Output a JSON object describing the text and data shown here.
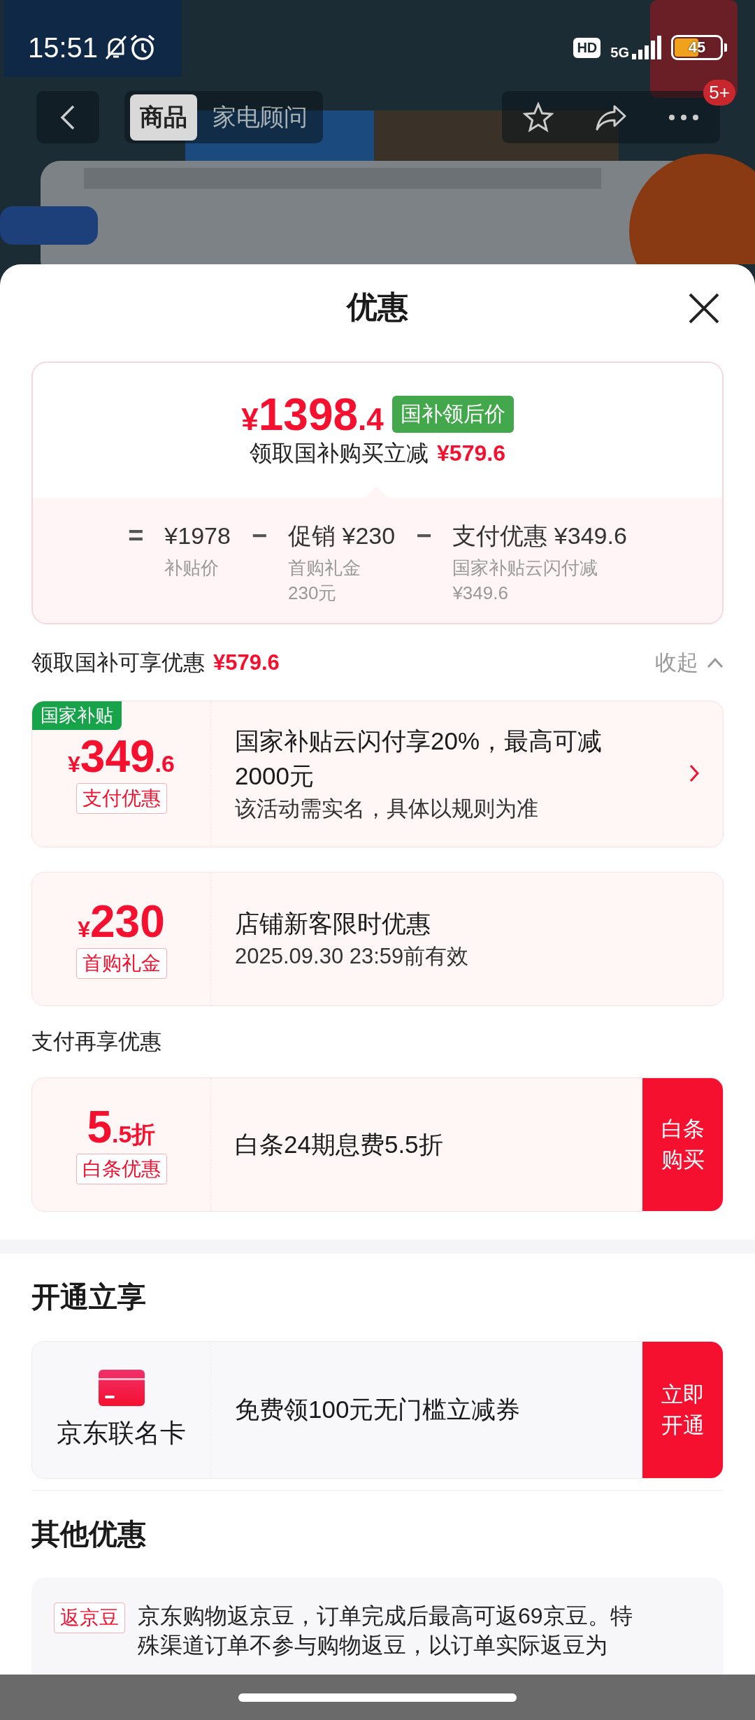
{
  "status_bar": {
    "time": "15:51",
    "hd": "HD",
    "network": "5G",
    "battery": "45"
  },
  "nav": {
    "tabs": [
      {
        "label": "商品",
        "selected": true
      },
      {
        "label": "家电顾问",
        "selected": false
      }
    ],
    "badge": "5+"
  },
  "sheet": {
    "title": "优惠"
  },
  "price_card": {
    "price": {
      "symbol": "¥",
      "integer": "1398",
      "decimal": ".4"
    },
    "tag": "国补领后价",
    "subtitle": "领取国补购买立减",
    "subtitle_amount": "¥579.6",
    "breakdown": [
      {
        "op": "=",
        "value": "¥1978",
        "label": "补贴价"
      },
      {
        "op": "−",
        "value": "促销 ¥230",
        "label": "首购礼金",
        "note": "230元"
      },
      {
        "op": "−",
        "value": "支付优惠 ¥349.6",
        "label": "国家补贴云闪付减",
        "note": "¥349.6"
      }
    ]
  },
  "summary": {
    "label": "领取国补可享优惠",
    "amount": "¥579.6",
    "toggle": "收起",
    "expanded": true
  },
  "coupons": [
    {
      "ribbon": "国家补贴",
      "symbol": "¥",
      "main": "349",
      "decimal": ".6",
      "tag": "支付优惠",
      "title": "国家补贴云闪付享20%，最高可减2000元",
      "desc": "该活动需实名，具体以规则为准",
      "action": {
        "kind": "chevron"
      }
    },
    {
      "symbol": "¥",
      "main": "230",
      "tag": "首购礼金",
      "title": "店铺新客限时优惠",
      "desc": "2025.09.30 23:59前有效"
    }
  ],
  "pay_section": {
    "title": "支付再享优惠",
    "coupons": [
      {
        "main": "5",
        "decimal": ".5折",
        "tag": "白条优惠",
        "title": "白条24期息费5.5折",
        "action": {
          "kind": "button",
          "label": "白条购买"
        }
      }
    ]
  },
  "open_section": {
    "title": "开通立享",
    "card": {
      "name": "京东联名卡",
      "title": "免费领100元无门槛立减券",
      "button": "立即开通"
    }
  },
  "other_section": {
    "title": "其他优惠",
    "items": [
      {
        "tag": "返京豆",
        "text": "京东购物返京豆，订单完成后最高可返69京豆。特殊渠道订单不参与购物返豆，以订单实际返豆为"
      }
    ]
  }
}
